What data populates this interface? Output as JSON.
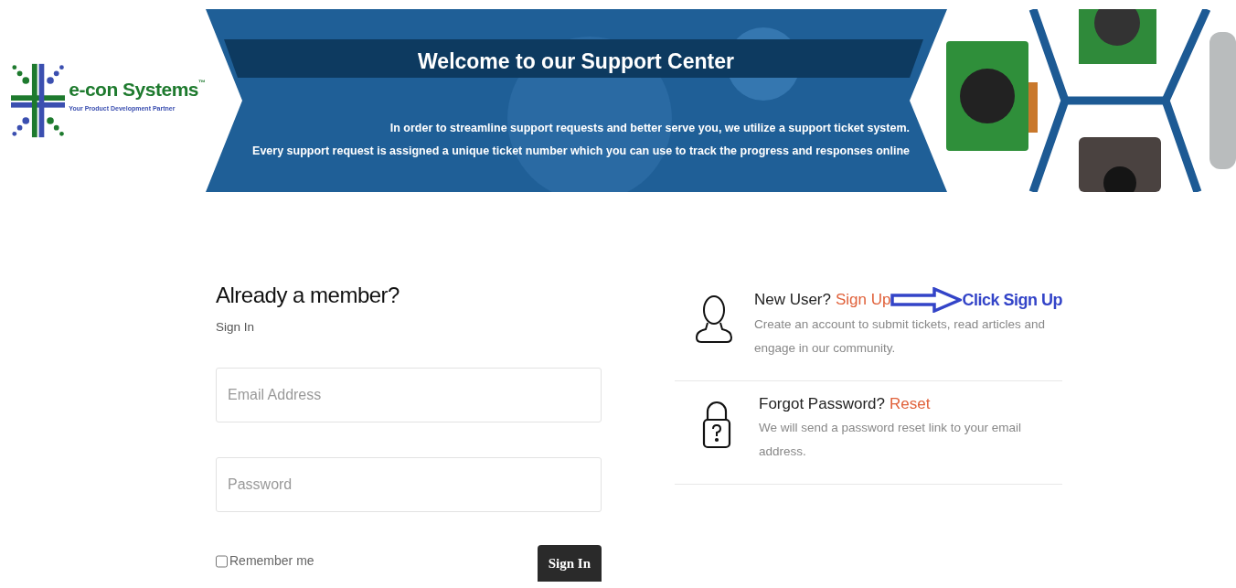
{
  "logo": {
    "name": "e-con Systems",
    "trademark": "™",
    "tagline": "Your Product Development Partner"
  },
  "banner": {
    "title": "Welcome to our Support Center",
    "lines": [
      "In order to streamline support requests and better serve you, we utilize a support ticket system.",
      "Every support request is assigned a unique ticket number which you can use to track the progress and responses online"
    ]
  },
  "signin": {
    "heading": "Already a member?",
    "subheading": "Sign In",
    "fields": [
      {
        "placeholder": "Email Address"
      },
      {
        "placeholder": "Password"
      }
    ],
    "remember": {
      "label": "Remember me",
      "checked": false
    },
    "button": "Sign In"
  },
  "options": [
    {
      "kind": "user",
      "question": "New User?",
      "link": "Sign Up",
      "description": "Create an account to submit tickets, read articles and engage in our community.",
      "annotation": "Click Sign Up"
    },
    {
      "kind": "lock",
      "question": "Forgot Password?",
      "link": "Reset",
      "description": "We will send a password reset link to your email address."
    }
  ]
}
